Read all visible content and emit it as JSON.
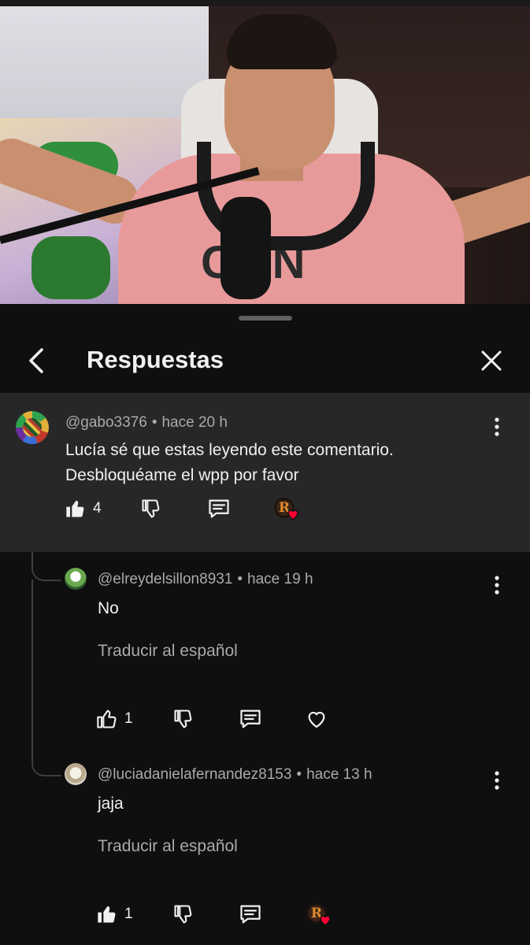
{
  "video": {
    "shirt_text": "CVIN"
  },
  "panel": {
    "title": "Respuestas"
  },
  "comment": {
    "author": "@gabo3376",
    "separator": "•",
    "time": "hace 20 h",
    "text": "Lucía sé que estas leyendo este comentario. Desbloquéame el wpp por favor",
    "likes": "4",
    "liked": true,
    "creator_heart": true,
    "creator_initial": "R"
  },
  "replies": [
    {
      "author": "@elreydelsillon8931",
      "separator": "•",
      "time": "hace 19 h",
      "text": "No",
      "translate": "Traducir al español",
      "likes": "1",
      "liked": false,
      "creator_heart": false
    },
    {
      "author": "@luciadanielafernandez8153",
      "separator": "•",
      "time": "hace 13 h",
      "text": "jaja",
      "translate": "Traducir al español",
      "likes": "1",
      "liked": true,
      "creator_heart": true,
      "creator_initial": "R"
    }
  ],
  "colors": {
    "background": "#0f0f0f",
    "highlight": "#272727",
    "text": "#f1f1f1",
    "muted": "#aaaaaa",
    "heart": "#ff0033"
  },
  "icons": [
    "back-arrow-icon",
    "close-icon",
    "more-vert-icon",
    "thumbs-up-icon",
    "thumbs-down-icon",
    "reply-icon",
    "heart-icon"
  ]
}
